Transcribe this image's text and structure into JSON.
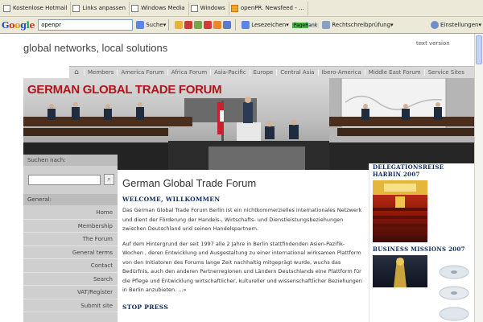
{
  "browser": {
    "bookmarks": [
      "Kostenlose Hotmail",
      "Links anpassen",
      "Windows Media",
      "Windows",
      "openPR. Newsfeed - ..."
    ],
    "google_toolbar": {
      "logo": "Google",
      "search_value": "openpr",
      "suche_label": "Suche",
      "leseszeichen_label": "Lesezeichen",
      "pagerank_label": "PageRank",
      "spellcheck_label": "Rechtschreibprüfung",
      "settings_label": "Einstellungen"
    }
  },
  "header": {
    "tagline": "global networks, local solutions",
    "text_version": "text version"
  },
  "nav": {
    "items": [
      "Members",
      "America Forum",
      "Africa Forum",
      "Asia-Pacific",
      "Europe",
      "Central Asia",
      "Ibero-America",
      "Middle East Forum",
      "Service Sites"
    ]
  },
  "banner": {
    "title": "GERMAN GLOBAL TRADE FORUM"
  },
  "sidebar": {
    "search_label": "Suchen nach:",
    "search_value": "",
    "general_label": "General:",
    "items": [
      "Home",
      "Membership",
      "The Forum",
      "General terms",
      "Contact",
      "Search",
      "VAT/Register",
      "Submit site"
    ]
  },
  "content": {
    "title": "German Global Trade Forum",
    "subtitle": "WELCOME, WILLKOMMEN",
    "para1": "Das German Global Trade Forum Berlin ist ein nichtkommerzielles internationales Netzwerk und dient der Förderung der Handels-, Wirtschafts- und Dienstleistungsbeziehungen zwischen Deutschland und seinen Handelspartnern.",
    "para2": "Auf dem Hintergrund der seit 1997 alle 2 Jahre in Berlin stattfindenden Asien-Pazifik-Wochen , deren Entwicklung und Ausgestaltung zu einer international wirksamen Plattform von den Initiatoren des Forums lange Zeit nachhaltig mitgeprägt wurde, wuchs das Bedürfnis, auch den anderen Partnerregionen und Ländern Deutschlands eine Plattform für die Pflege und Entwicklung wirtschaftlicher, kultureller und wissenschaftlicher Beziehungen in Berlin anzubieten.",
    "more": "...»",
    "next_heading": "STOP PRESS"
  },
  "right": {
    "box1_title": "DELEGATIONSREISE HARBIN 2007",
    "box2_title": "BUSINESS MISSIONS 2007"
  },
  "colors": {
    "banner_title": "#b0131b",
    "heading_navy": "#0d2a5e",
    "nav_gray": "#d9d9d9",
    "sidebar_gray": "#cfcfcf"
  }
}
